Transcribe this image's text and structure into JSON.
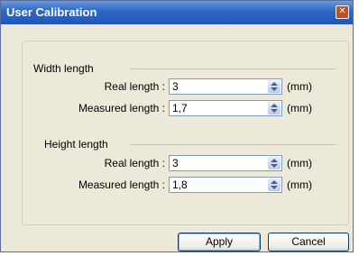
{
  "window": {
    "title": "User Calibration"
  },
  "width_group": {
    "label": "Width length",
    "real_label": "Real length :",
    "real_value": "3",
    "measured_label": "Measured length  :",
    "measured_value": "1,7",
    "unit": "(mm)"
  },
  "height_group": {
    "label": "Height length",
    "real_label": "Real length :",
    "real_value": "3",
    "measured_label": "Measured length :",
    "measured_value": "1,8",
    "unit": "(mm)"
  },
  "buttons": {
    "apply": "Apply",
    "cancel": "Cancel"
  },
  "icons": {
    "close": "close-icon",
    "spin": "spin-arrows-icon"
  }
}
